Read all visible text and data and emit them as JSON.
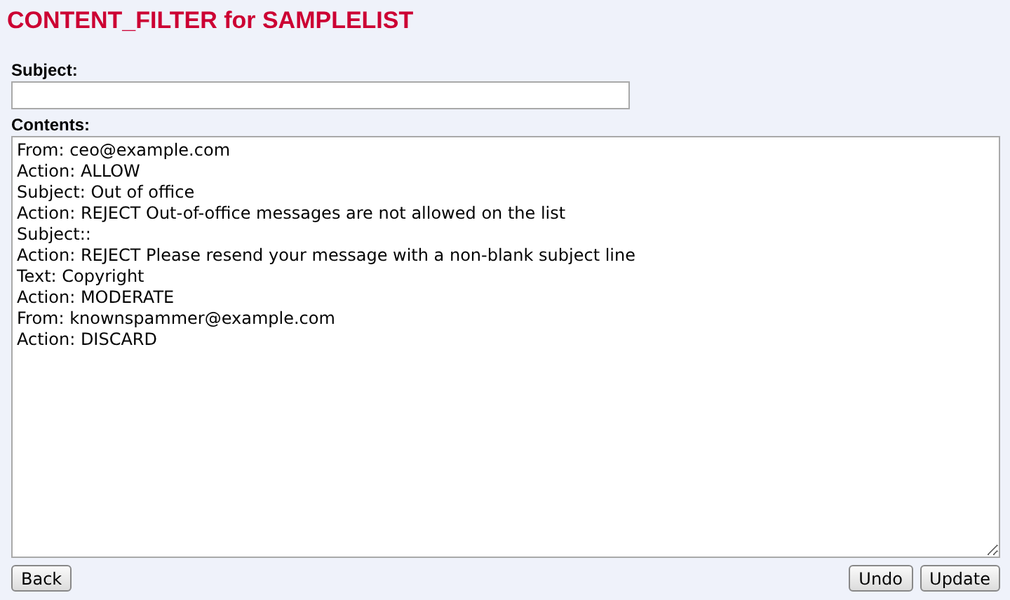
{
  "title": "CONTENT_FILTER for SAMPLELIST",
  "subject": {
    "label": "Subject:"
  },
  "contents": {
    "label": "Contents:",
    "value": "From: ceo@example.com\nAction: ALLOW\nSubject: Out of office\nAction: REJECT Out-of-office messages are not allowed on the list\nSubject::\nAction: REJECT Please resend your message with a non-blank subject line\nText: Copyright\nAction: MODERATE\nFrom: knownspammer@example.com\nAction: DISCARD"
  },
  "buttons_left": [
    "Back"
  ],
  "buttons_right": [
    "Undo",
    "Update"
  ]
}
